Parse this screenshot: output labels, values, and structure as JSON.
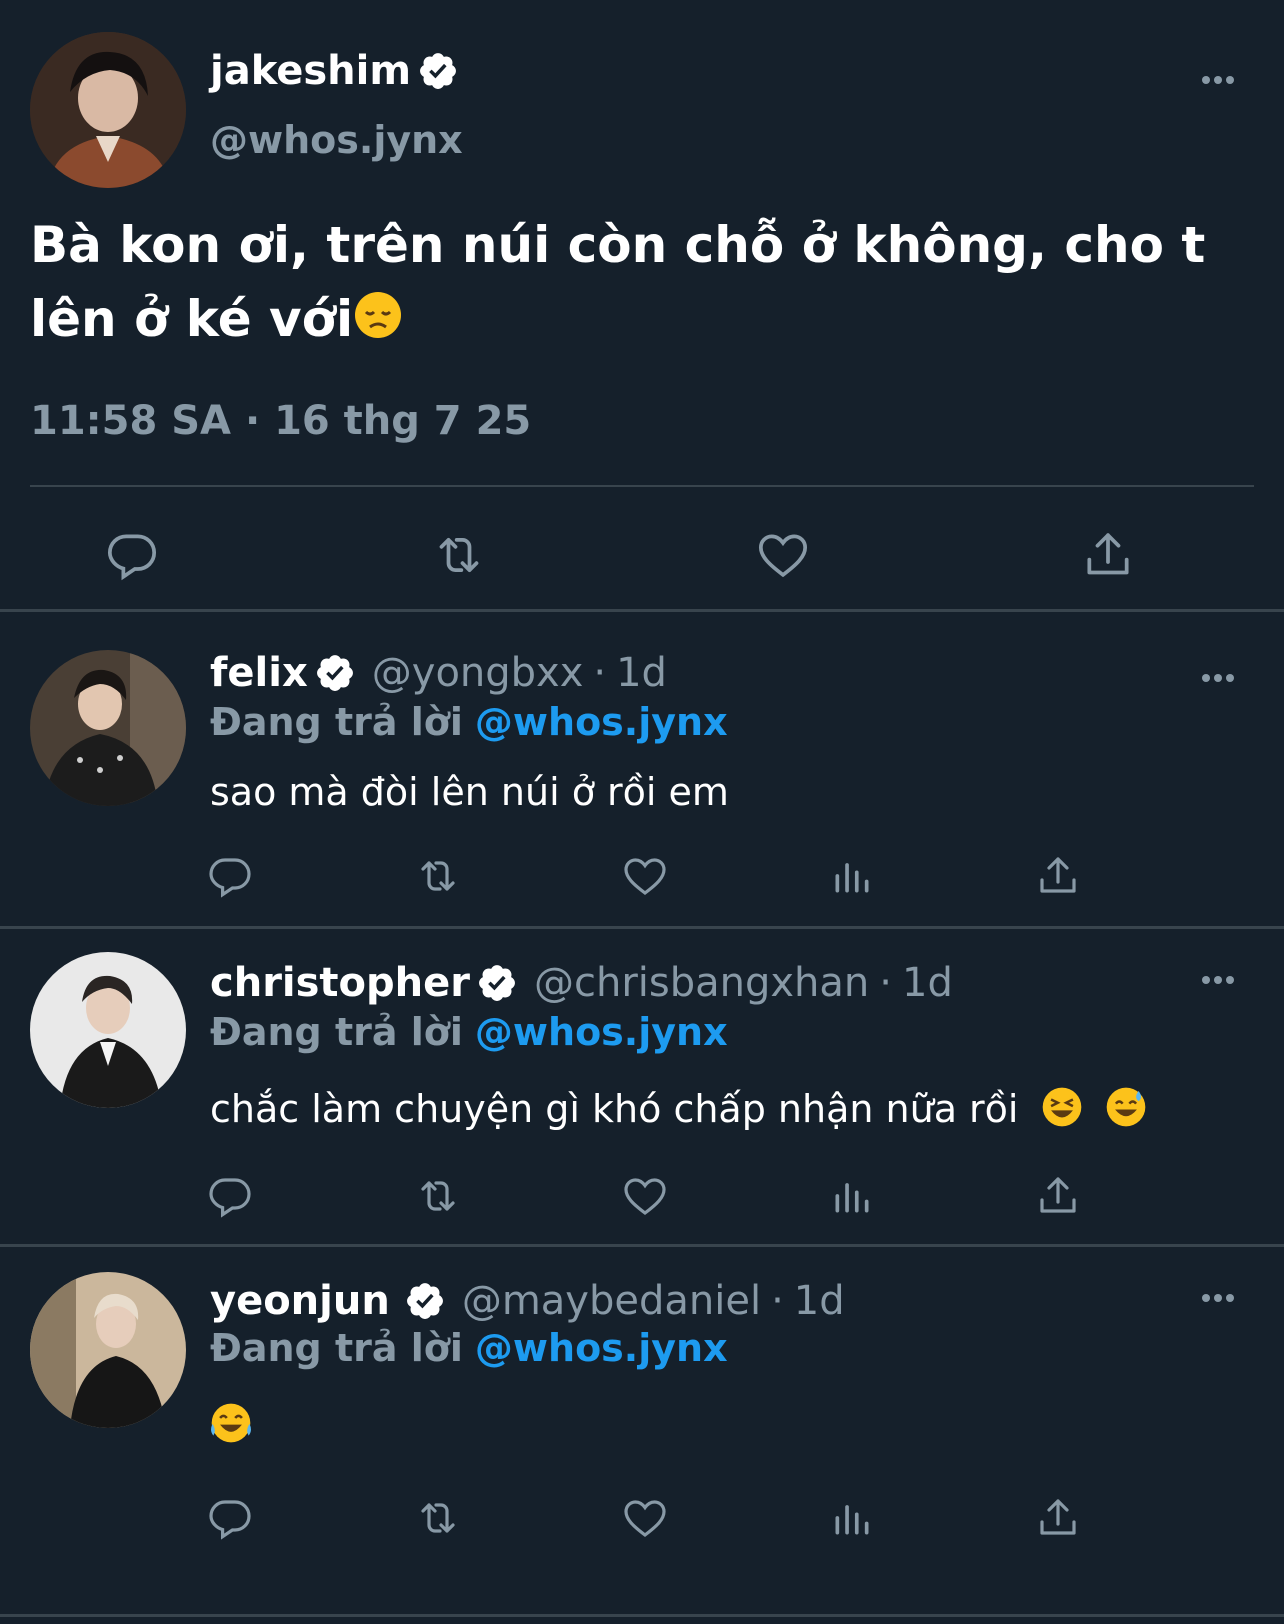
{
  "main": {
    "display_name": "jakeshim",
    "handle": "@whos.jynx",
    "text": "Bà kon ơi, trên núi còn chỗ ở không, cho t lên ở ké với",
    "emoji": "disappointed-face-emoji",
    "timestamp": "11:58 SA · 16 thg 7 25",
    "actions": [
      "reply-icon",
      "retweet-icon",
      "like-icon",
      "share-icon"
    ]
  },
  "replies": [
    {
      "display_name": "felix",
      "handle": "@yongbxx",
      "time": "1d",
      "replying_label": "Đang trả lời",
      "replying_to": "@whos.jynx",
      "text": "sao mà đòi lên núi ở rồi em",
      "emojis": []
    },
    {
      "display_name": "christopher",
      "handle": "@chrisbangxhan",
      "time": "1d",
      "replying_label": "Đang trả lời",
      "replying_to": "@whos.jynx",
      "text": "chắc làm chuyện gì khó chấp nhận nữa rồi",
      "emojis": [
        "laughing-squint-emoji",
        "grinning-sweat-emoji"
      ]
    },
    {
      "display_name": "yeonjun",
      "handle": "@maybedaniel",
      "time": "1d",
      "replying_label": "Đang trả lời",
      "replying_to": "@whos.jynx",
      "text": "",
      "emojis": [
        "tears-of-joy-emoji"
      ]
    }
  ],
  "separator": "·",
  "colors": {
    "background": "#15202b",
    "text": "#ffffff",
    "muted": "#8899a6",
    "link": "#1d9bf0",
    "divider": "#38444d"
  }
}
